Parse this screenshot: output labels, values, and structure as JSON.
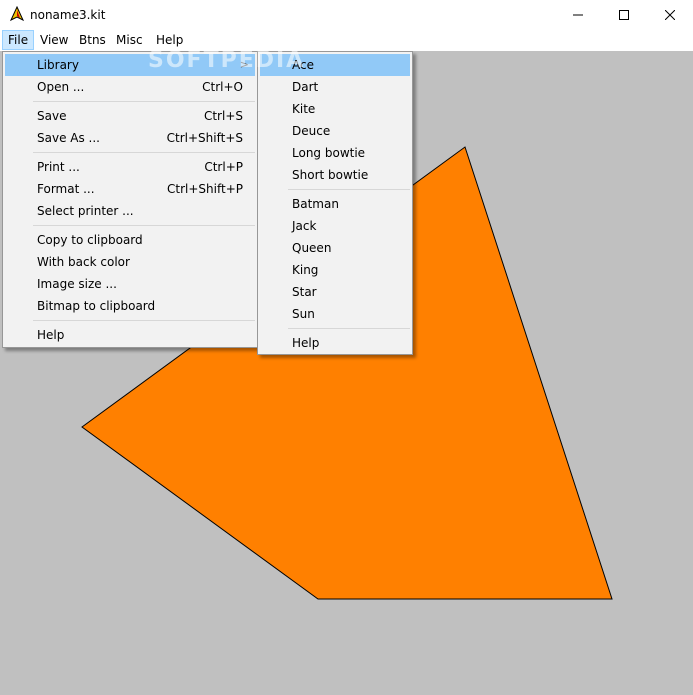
{
  "window": {
    "title": "noname3.kit",
    "controls": {
      "minimize": "—",
      "maximize": "☐",
      "close": "✕"
    }
  },
  "menubar": {
    "items": [
      "File",
      "View",
      "Btns",
      "Misc",
      "Help"
    ],
    "active": "File"
  },
  "file_menu": {
    "items": [
      {
        "label": "Library",
        "shortcut": "",
        "submenu": true
      },
      {
        "label": "Open ...",
        "shortcut": "Ctrl+O"
      },
      {
        "label": "Save",
        "shortcut": "Ctrl+S"
      },
      {
        "label": "Save As ...",
        "shortcut": "Ctrl+Shift+S"
      },
      {
        "label": "Print ...",
        "shortcut": "Ctrl+P"
      },
      {
        "label": "Format ...",
        "shortcut": "Ctrl+Shift+P"
      },
      {
        "label": "Select printer ...",
        "shortcut": ""
      },
      {
        "label": "Copy to clipboard",
        "shortcut": ""
      },
      {
        "label": "With back color",
        "shortcut": ""
      },
      {
        "label": "Image size ...",
        "shortcut": ""
      },
      {
        "label": "Bitmap to clipboard",
        "shortcut": ""
      },
      {
        "label": "Help",
        "shortcut": ""
      }
    ]
  },
  "library_menu": {
    "items": [
      "Ace",
      "Dart",
      "Kite",
      "Deuce",
      "Long bowtie",
      "Short bowtie",
      "Batman",
      "Jack",
      "Queen",
      "King",
      "Star",
      "Sun",
      "Help"
    ],
    "highlighted": "Ace"
  },
  "watermark": "SOFTPEDIA",
  "colors": {
    "canvas_bg": "#c0c0c0",
    "kite_fill": "#ff8000",
    "menu_highlight": "#91c9f7"
  }
}
